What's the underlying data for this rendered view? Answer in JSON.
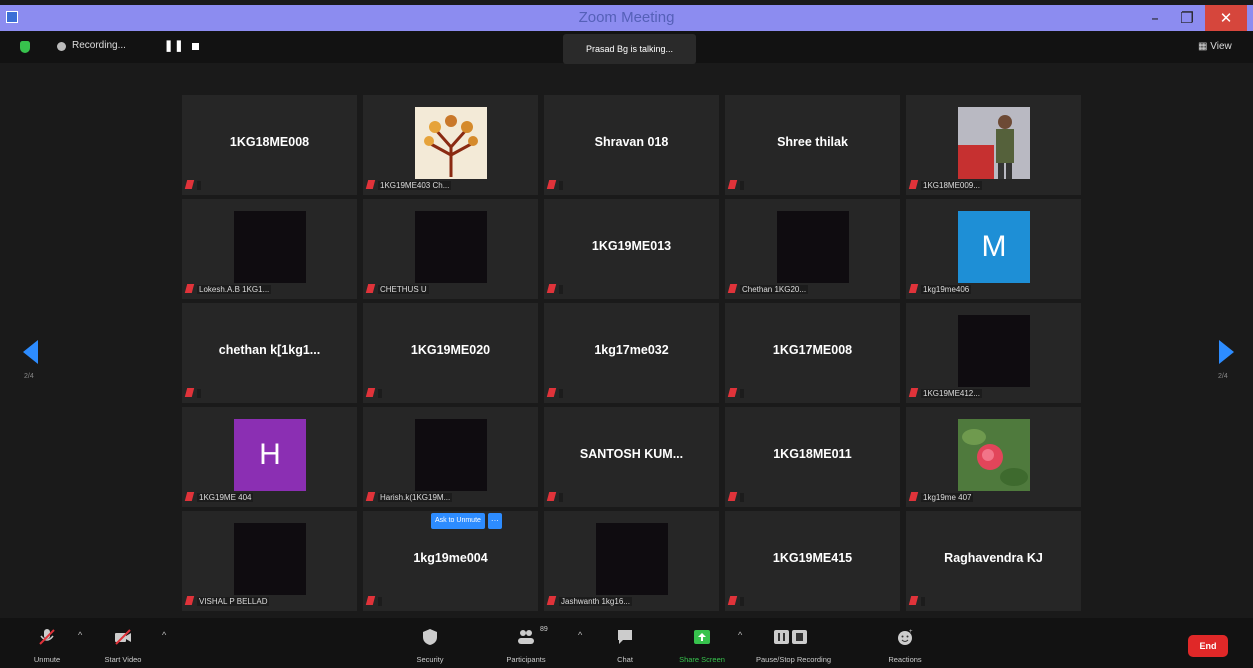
{
  "window": {
    "title": "Zoom Meeting",
    "minimize": "–",
    "maximize": "❐",
    "close": "✕"
  },
  "topbar": {
    "recording_label": "Recording...",
    "pause_symbol": "❚❚",
    "talking": "Prasad Bg is talking...",
    "view_label": "▦ View"
  },
  "pager": {
    "left": "2/4",
    "right": "2/4"
  },
  "ask_unmute": {
    "label": "Ask to Unmute",
    "more": "···"
  },
  "tiles": [
    {
      "name": "1KG18ME008",
      "label": ""
    },
    {
      "name": "",
      "label": "1KG19ME403 Ch...",
      "image": "tree-art"
    },
    {
      "name": "Shravan 018",
      "label": ""
    },
    {
      "name": "Shree thilak",
      "label": ""
    },
    {
      "name": "",
      "label": "1KG18ME009...",
      "image": "person-photo"
    },
    {
      "name": "",
      "label": "Lokesh.A.B 1KG1...",
      "image": "dark"
    },
    {
      "name": "",
      "label": "CHETHUS U",
      "image": "dark"
    },
    {
      "name": "1KG19ME013",
      "label": ""
    },
    {
      "name": "",
      "label": "Chethan 1KG20...",
      "image": "dark"
    },
    {
      "name": "",
      "label": "1kg19me406",
      "avatar": "M",
      "avatar_color": "#1e8fd6"
    },
    {
      "name": "chethan k[1kg1...",
      "label": ""
    },
    {
      "name": "1KG19ME020",
      "label": ""
    },
    {
      "name": "1kg17me032",
      "label": ""
    },
    {
      "name": "1KG17ME008",
      "label": ""
    },
    {
      "name": "",
      "label": "1KG19ME412...",
      "image": "dark"
    },
    {
      "name": "",
      "label": "1KG19ME 404",
      "avatar": "H",
      "avatar_color": "#8b2fb3"
    },
    {
      "name": "",
      "label": "Harish.k(1KG19M...",
      "image": "dark"
    },
    {
      "name": "SANTOSH KUM...",
      "label": ""
    },
    {
      "name": "1KG18ME011",
      "label": ""
    },
    {
      "name": "",
      "label": "1kg19me 407",
      "image": "flower-photo"
    },
    {
      "name": "",
      "label": "VISHAL P BELLAD",
      "image": "dark"
    },
    {
      "name": "1kg19me004",
      "label": ""
    },
    {
      "name": "",
      "label": "Jashwanth 1kg16...",
      "image": "dark"
    },
    {
      "name": "1KG19ME415",
      "label": ""
    },
    {
      "name": "Raghavendra KJ",
      "label": ""
    }
  ],
  "toolbar": {
    "unmute": "Unmute",
    "start_video": "Start Video",
    "security": "Security",
    "participants": "Participants",
    "participants_count": "89",
    "chat": "Chat",
    "share_screen": "Share Screen",
    "pause_stop_recording": "Pause/Stop Recording",
    "reactions": "Reactions",
    "end": "End"
  }
}
